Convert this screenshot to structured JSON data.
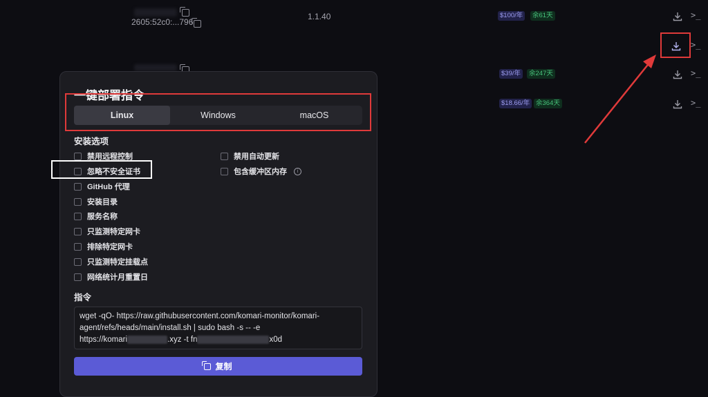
{
  "background_rows": {
    "row1": {
      "ip": "2605:52c0:...796",
      "version": "1.1.40",
      "price": "$100/年",
      "remaining": "余61天"
    },
    "row3": {
      "price": "$39/年",
      "remaining": "余247天"
    },
    "row4": {
      "price": "$18.66/年",
      "remaining": "余364天"
    },
    "terminal_glyph": ">_"
  },
  "modal": {
    "title": "一键部署指令",
    "tabs": [
      {
        "label": "Linux",
        "active": true
      },
      {
        "label": "Windows",
        "active": false
      },
      {
        "label": "macOS",
        "active": false
      }
    ],
    "options_title": "安装选项",
    "options_left": [
      "禁用远程控制",
      "忽略不安全证书",
      "GitHub 代理",
      "安装目录",
      "服务名称",
      "只监测特定网卡",
      "排除特定网卡",
      "只监测特定挂载点",
      "网络统计月重置日"
    ],
    "options_right": [
      "禁用自动更新",
      "包含缓冲区内存"
    ],
    "info_glyph": "i",
    "command_title": "指令",
    "command": {
      "line1": "wget -qO- https://raw.githubusercontent.com/komari-monitor/komari-",
      "line2": "agent/refs/heads/main/install.sh | sudo bash -s -- -e",
      "line3_a": "https://komari",
      "line3_b": ".xyz -t fn",
      "line3_c": "x0d"
    },
    "copy_label": "复制"
  },
  "colors": {
    "accent": "#5b5bd6",
    "annotation_red": "#e03a3a",
    "badge_green": "#48c47c",
    "badge_purple": "#9c9cf0"
  },
  "icons": [
    "download-icon",
    "terminal-icon",
    "copy-icon",
    "info-icon"
  ]
}
